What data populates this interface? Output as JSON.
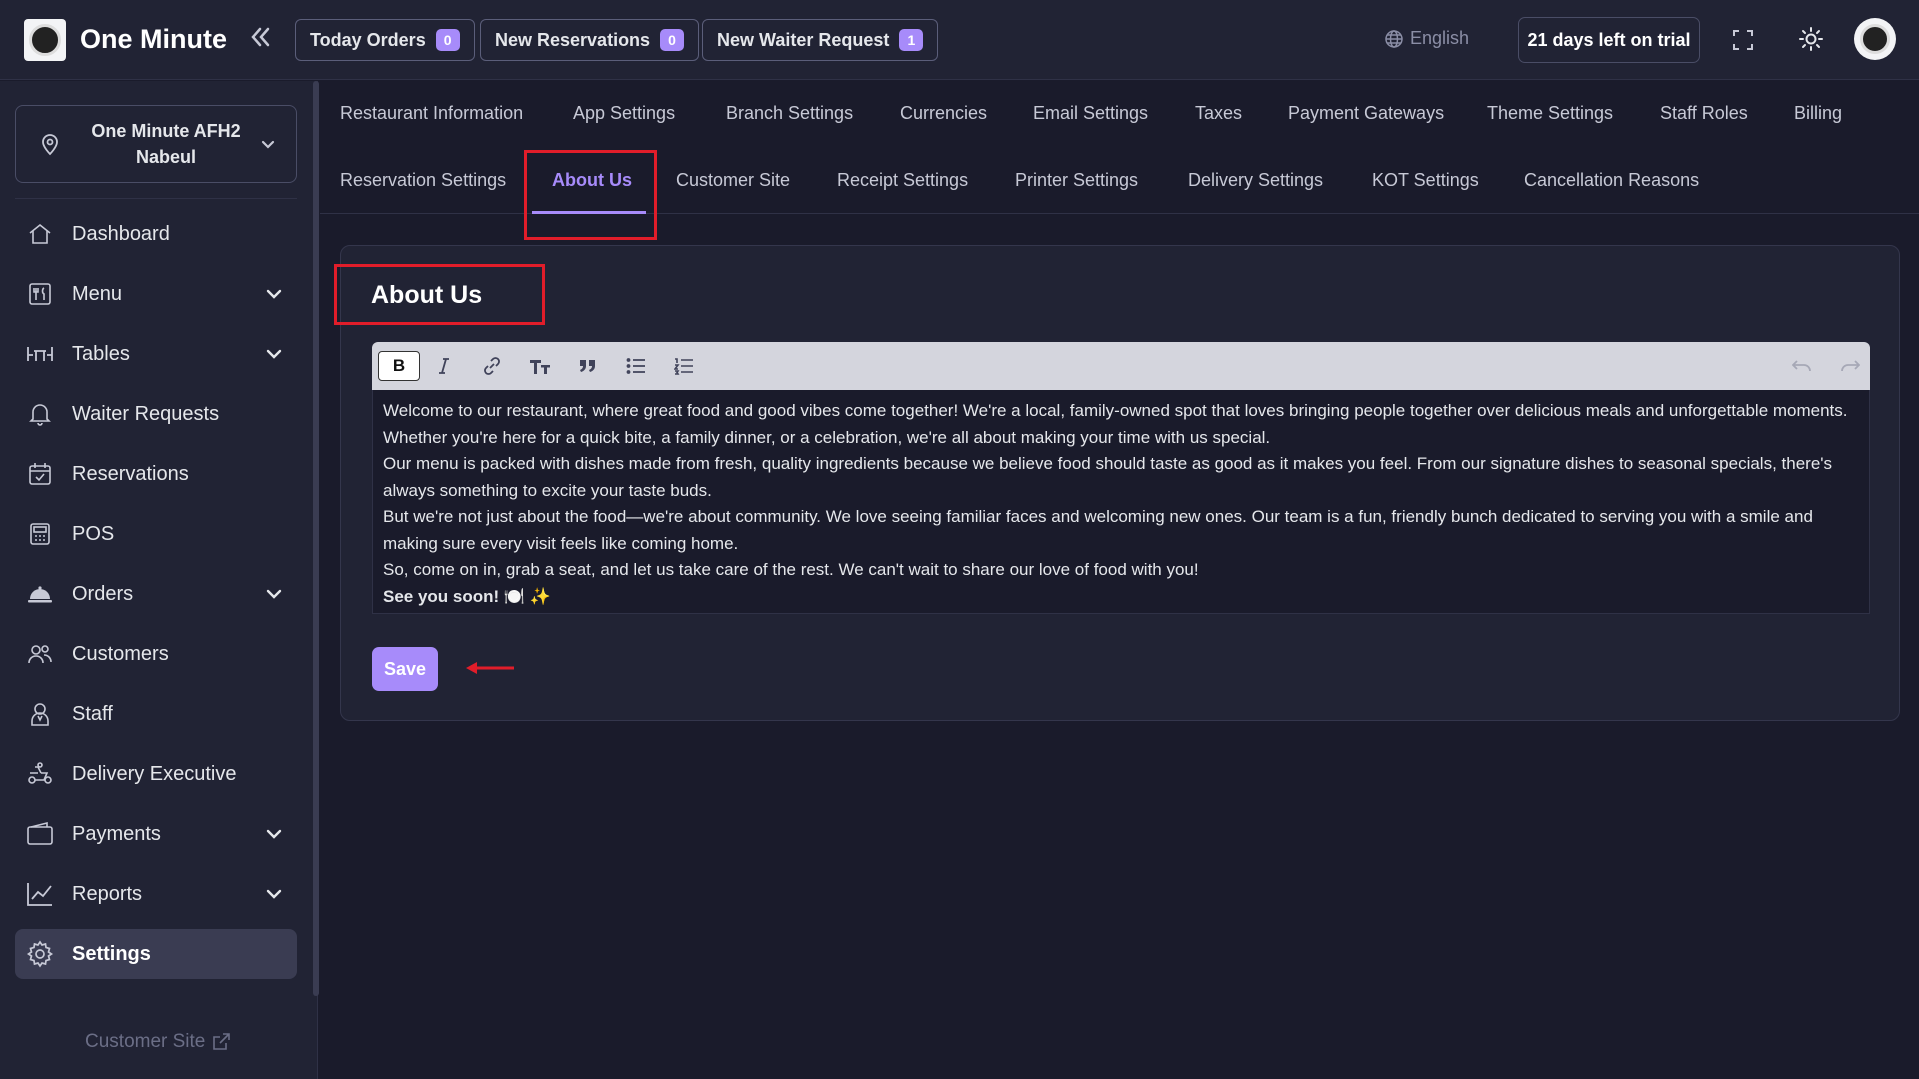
{
  "header": {
    "app_title": "One Minute",
    "buttons": [
      {
        "label": "Today Orders",
        "count": "0"
      },
      {
        "label": "New Reservations",
        "count": "0"
      },
      {
        "label": "New Waiter Request",
        "count": "1"
      }
    ],
    "language": "English",
    "trial": "21 days left on trial"
  },
  "sidebar": {
    "branch_line1": "One Minute AFH2",
    "branch_line2": "Nabeul",
    "items": [
      {
        "label": "Dashboard"
      },
      {
        "label": "Menu"
      },
      {
        "label": "Tables"
      },
      {
        "label": "Waiter Requests"
      },
      {
        "label": "Reservations"
      },
      {
        "label": "POS"
      },
      {
        "label": "Orders"
      },
      {
        "label": "Customers"
      },
      {
        "label": "Staff"
      },
      {
        "label": "Delivery Executive"
      },
      {
        "label": "Payments"
      },
      {
        "label": "Reports"
      },
      {
        "label": "Settings"
      }
    ],
    "active_item": "Settings",
    "customer_site": "Customer Site"
  },
  "tabs": {
    "row1": [
      "Restaurant Information",
      "App Settings",
      "Branch Settings",
      "Currencies",
      "Email Settings",
      "Taxes",
      "Payment Gateways",
      "Theme Settings",
      "Staff Roles",
      "Billing"
    ],
    "row2": [
      "Reservation Settings",
      "About Us",
      "Customer Site",
      "Receipt Settings",
      "Printer Settings",
      "Delivery Settings",
      "KOT Settings",
      "Cancellation Reasons"
    ],
    "active": "About Us"
  },
  "about": {
    "title": "About Us",
    "paragraphs": [
      " Welcome to our restaurant, where great food and good vibes come together! We're a local, family-owned spot that loves bringing people together over delicious meals and unforgettable moments. Whether you're here for a quick bite, a family dinner, or a celebration, we're all about making your time with us special.",
      " Our menu is packed with dishes made from fresh, quality ingredients because we believe food should taste as good as it makes you feel. From our signature dishes to seasonal specials, there's always something to excite your taste buds.",
      " But we're not just about the food—we're about community. We love seeing familiar faces and welcoming new ones. Our team is a fun, friendly bunch dedicated to serving you with a smile and making sure every visit feels like coming home.",
      " So, come on in, grab a seat, and let us take care of the rest. We can't wait to share our love of food with you!"
    ],
    "signoff": "See you soon! 🍽️ ✨",
    "save_label": "Save"
  },
  "colors": {
    "accent": "#a78bfa",
    "highlight": "#e11d2a",
    "background": "#1a1b2b",
    "panel": "#212334"
  }
}
